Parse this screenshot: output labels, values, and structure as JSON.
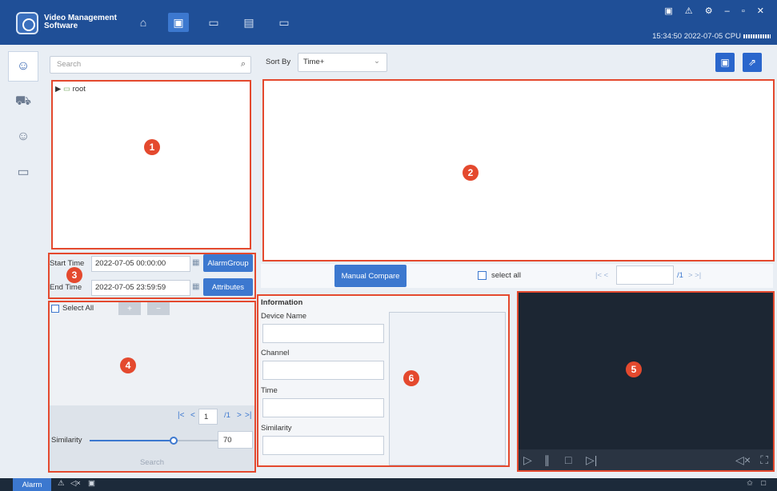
{
  "header": {
    "app_title_line1": "Video Management",
    "app_title_line2": "Software",
    "nav_icons": [
      "home-icon",
      "face-search-icon",
      "camera-icon",
      "playback-icon",
      "storage-icon"
    ],
    "window_controls": "▣ ⚠ ⚙ – ▫ ✕",
    "clock": "15:34:50 2022-07-05 CPU"
  },
  "rail": {
    "icons": [
      "face-icon",
      "vehicle-icon",
      "person-icon",
      "plate-icon"
    ]
  },
  "search": {
    "placeholder": "Search"
  },
  "tree": {
    "root_label": "root"
  },
  "filters": {
    "start_label": "Start Time",
    "start_value": "2022-07-05 00:00:00",
    "end_label": "End Time",
    "end_value": "2022-07-05 23:59:59",
    "alarm_group_button": "AlarmGroup",
    "attributes_button": "Attributes"
  },
  "results_left": {
    "select_all_label": "Select All",
    "add_button": "+",
    "delete_button": "−",
    "page_current": "1",
    "page_total": "/1",
    "similarity_label": "Similarity",
    "similarity_value": "70",
    "similarity_fraction": 0.7,
    "search_button": "Search"
  },
  "toolbar": {
    "sort_label": "Sort By",
    "sort_value": "Time+"
  },
  "compare": {
    "manual_compare_button": "Manual Compare",
    "select_all_label": "select all",
    "page_total": "/1"
  },
  "info": {
    "title": "Information",
    "device_name_label": "Device Name",
    "channel_label": "Channel",
    "time_label": "Time",
    "similarity_label": "Similarity"
  },
  "badges": [
    "1",
    "2",
    "3",
    "4",
    "5",
    "6"
  ],
  "taskbar": {
    "alarm_label": "Alarm"
  },
  "colors": {
    "header_bg": "#1f4f97",
    "accent": "#3c78cf",
    "annotation_red": "#e4492e"
  }
}
